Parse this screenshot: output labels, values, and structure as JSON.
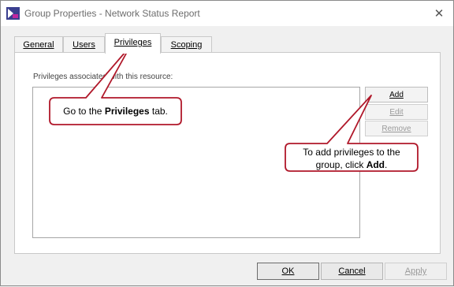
{
  "window": {
    "title": "Group Properties - Network Status Report",
    "close_glyph": "✕"
  },
  "tabs": [
    {
      "label": "General",
      "active": false
    },
    {
      "label": "Users",
      "active": false
    },
    {
      "label": "Privileges",
      "active": true
    },
    {
      "label": "Scoping",
      "active": false
    }
  ],
  "privileges": {
    "list_label": "Privileges associated with this resource:",
    "buttons": {
      "add": "Add",
      "edit": "Edit",
      "remove": "Remove"
    }
  },
  "footer": {
    "ok": "OK",
    "cancel": "Cancel",
    "apply": "Apply"
  },
  "callouts": {
    "tab": {
      "text_before": "Go to the",
      "bold": "Privileges",
      "text_after": "tab."
    },
    "add": {
      "line1": "To add privileges to the",
      "line2_before": "group, click",
      "bold": "Add",
      "line2_after": "."
    }
  },
  "colors": {
    "callout_border": "#b0182a",
    "app_icon": "#3a3f8f"
  },
  "icons": {
    "app": "app-logo-icon",
    "close": "close-icon"
  }
}
